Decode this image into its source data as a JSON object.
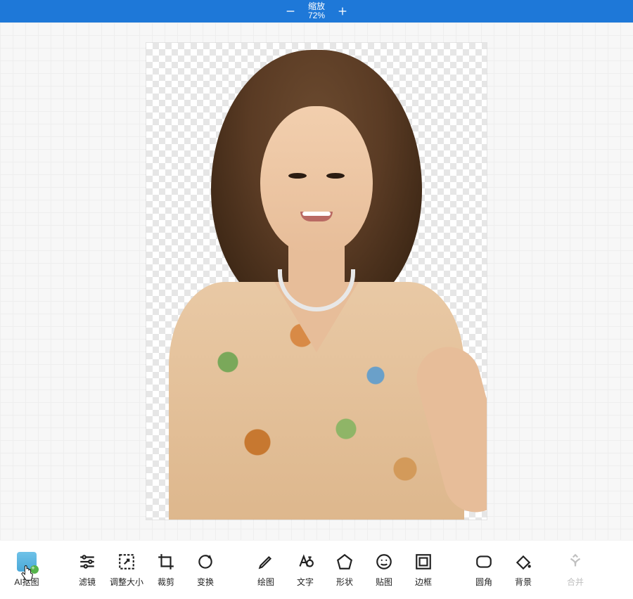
{
  "zoom": {
    "label": "缩放",
    "value": "72%",
    "minus_icon": "minus",
    "plus_icon": "plus"
  },
  "canvas": {
    "transparent_background": true,
    "content_description": "portrait-photo-cutout"
  },
  "toolbar": {
    "items": [
      {
        "key": "ai-cutout",
        "label": "AI抠图",
        "icon": "ai-cutout-icon",
        "active": true
      },
      {
        "key": "filter",
        "label": "滤镜",
        "icon": "sliders-icon"
      },
      {
        "key": "resize",
        "label": "调整大小",
        "icon": "resize-icon"
      },
      {
        "key": "crop",
        "label": "裁剪",
        "icon": "crop-icon"
      },
      {
        "key": "transform",
        "label": "变换",
        "icon": "rotate-icon"
      },
      {
        "key": "draw",
        "label": "绘图",
        "icon": "pencil-icon"
      },
      {
        "key": "text",
        "label": "文字",
        "icon": "text-icon"
      },
      {
        "key": "shape",
        "label": "形状",
        "icon": "pentagon-icon"
      },
      {
        "key": "sticker",
        "label": "贴图",
        "icon": "smile-icon"
      },
      {
        "key": "border",
        "label": "边框",
        "icon": "frame-icon"
      },
      {
        "key": "radius",
        "label": "圆角",
        "icon": "rounded-rect-icon"
      },
      {
        "key": "background",
        "label": "背景",
        "icon": "paint-bucket-icon"
      },
      {
        "key": "merge",
        "label": "合并",
        "icon": "merge-up-icon",
        "disabled": true
      }
    ]
  }
}
